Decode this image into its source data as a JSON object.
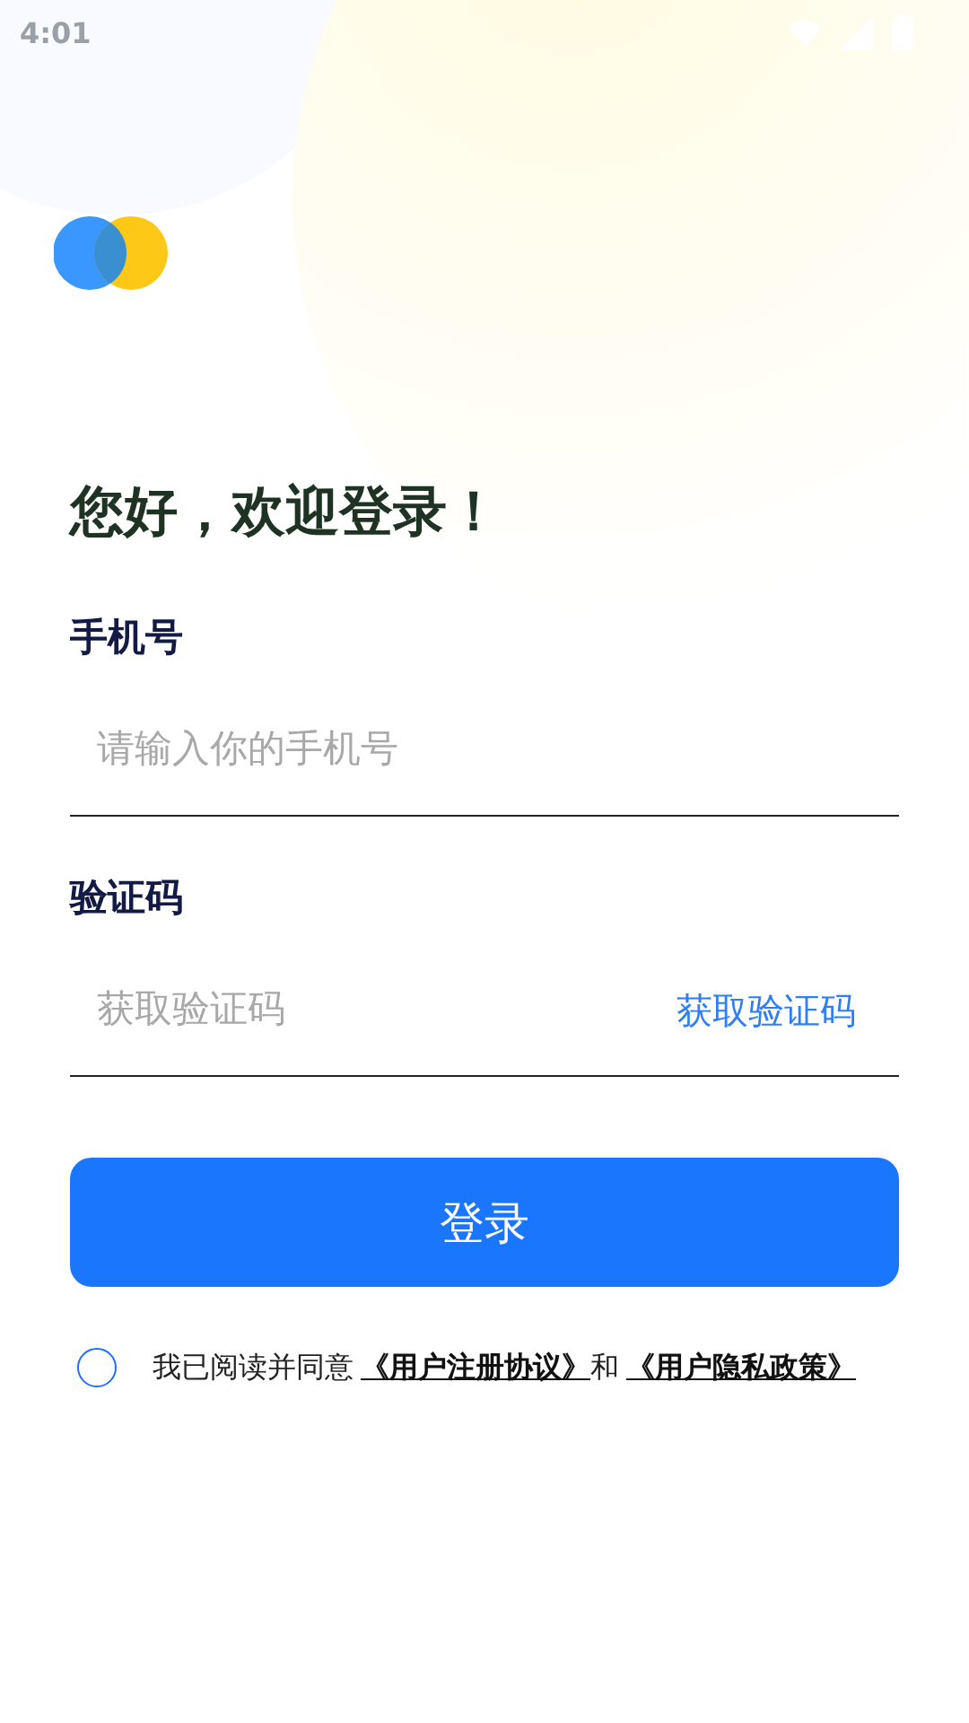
{
  "status_bar": {
    "time": "4:01"
  },
  "greeting": "您好，欢迎登录！",
  "phone": {
    "label": "手机号",
    "placeholder": "请输入你的手机号"
  },
  "code": {
    "label": "验证码",
    "placeholder": "获取验证码",
    "action": "获取验证码"
  },
  "login_button": "登录",
  "agreement": {
    "checked": false,
    "text": "我已阅读并同意",
    "link_1": "《用户注册协议》",
    "joiner": "和",
    "link_2": "《用户隐私政策》"
  }
}
